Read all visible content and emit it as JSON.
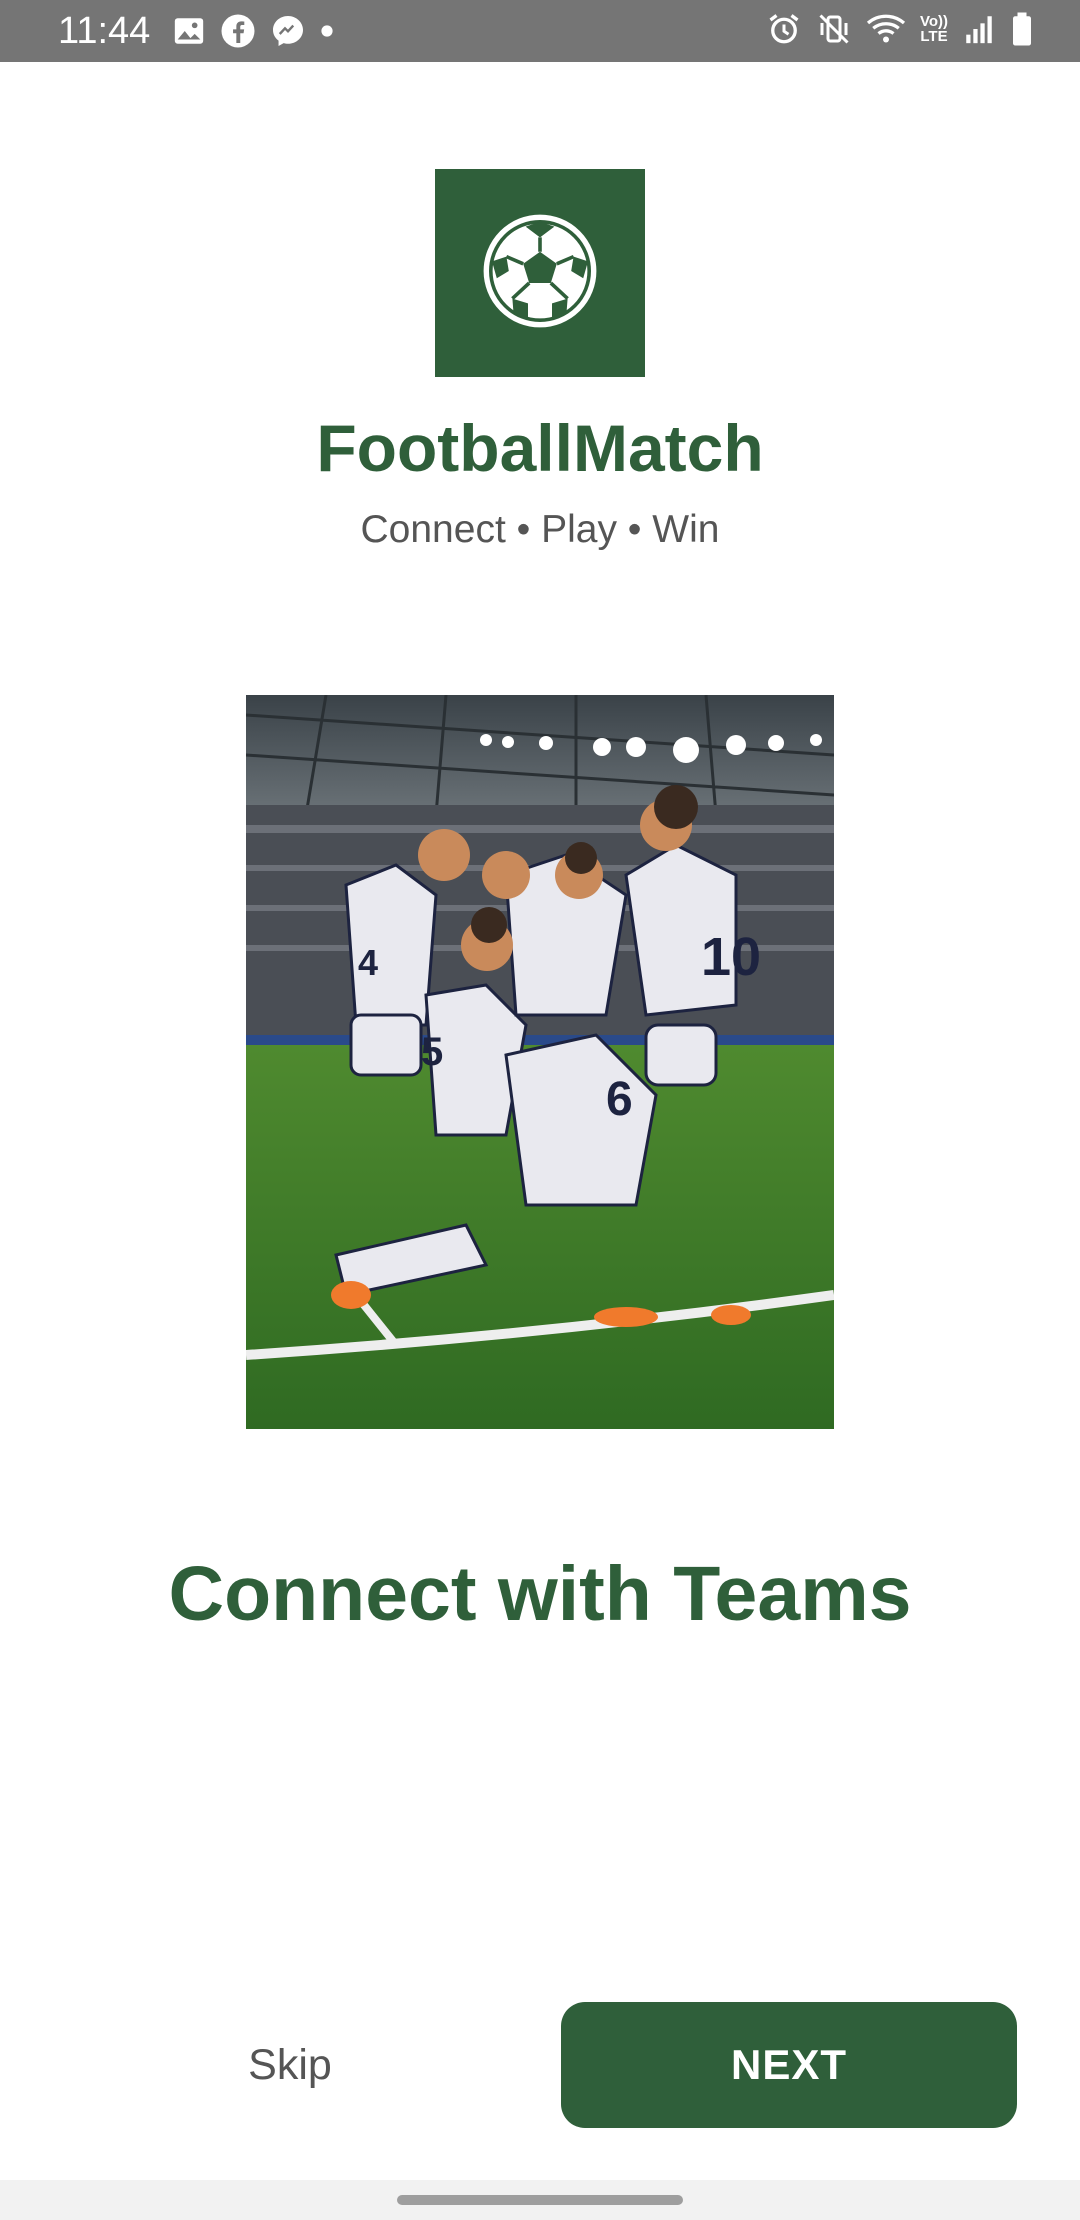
{
  "colors": {
    "brand": "#2f5f3a",
    "status_bar": "#757575"
  },
  "status_bar": {
    "time": "11:44",
    "left_icons": [
      "image-icon",
      "facebook-icon",
      "messenger-icon",
      "dot-icon"
    ],
    "right_icons": [
      "alarm-icon",
      "vibrate-icon",
      "wifi-icon",
      "volte-icon",
      "signal-icon",
      "battery-icon"
    ],
    "volte_label_top": "Vo))",
    "volte_label_bottom": "LTE"
  },
  "brand": {
    "logo_icon": "soccer-ball-icon",
    "app_name": "FootballMatch",
    "tagline": "Connect • Play • Win"
  },
  "onboarding": {
    "image_description_icon": "team-celebration-photo",
    "headline": "Connect with Teams"
  },
  "actions": {
    "skip_label": "Skip",
    "next_label": "NEXT"
  }
}
